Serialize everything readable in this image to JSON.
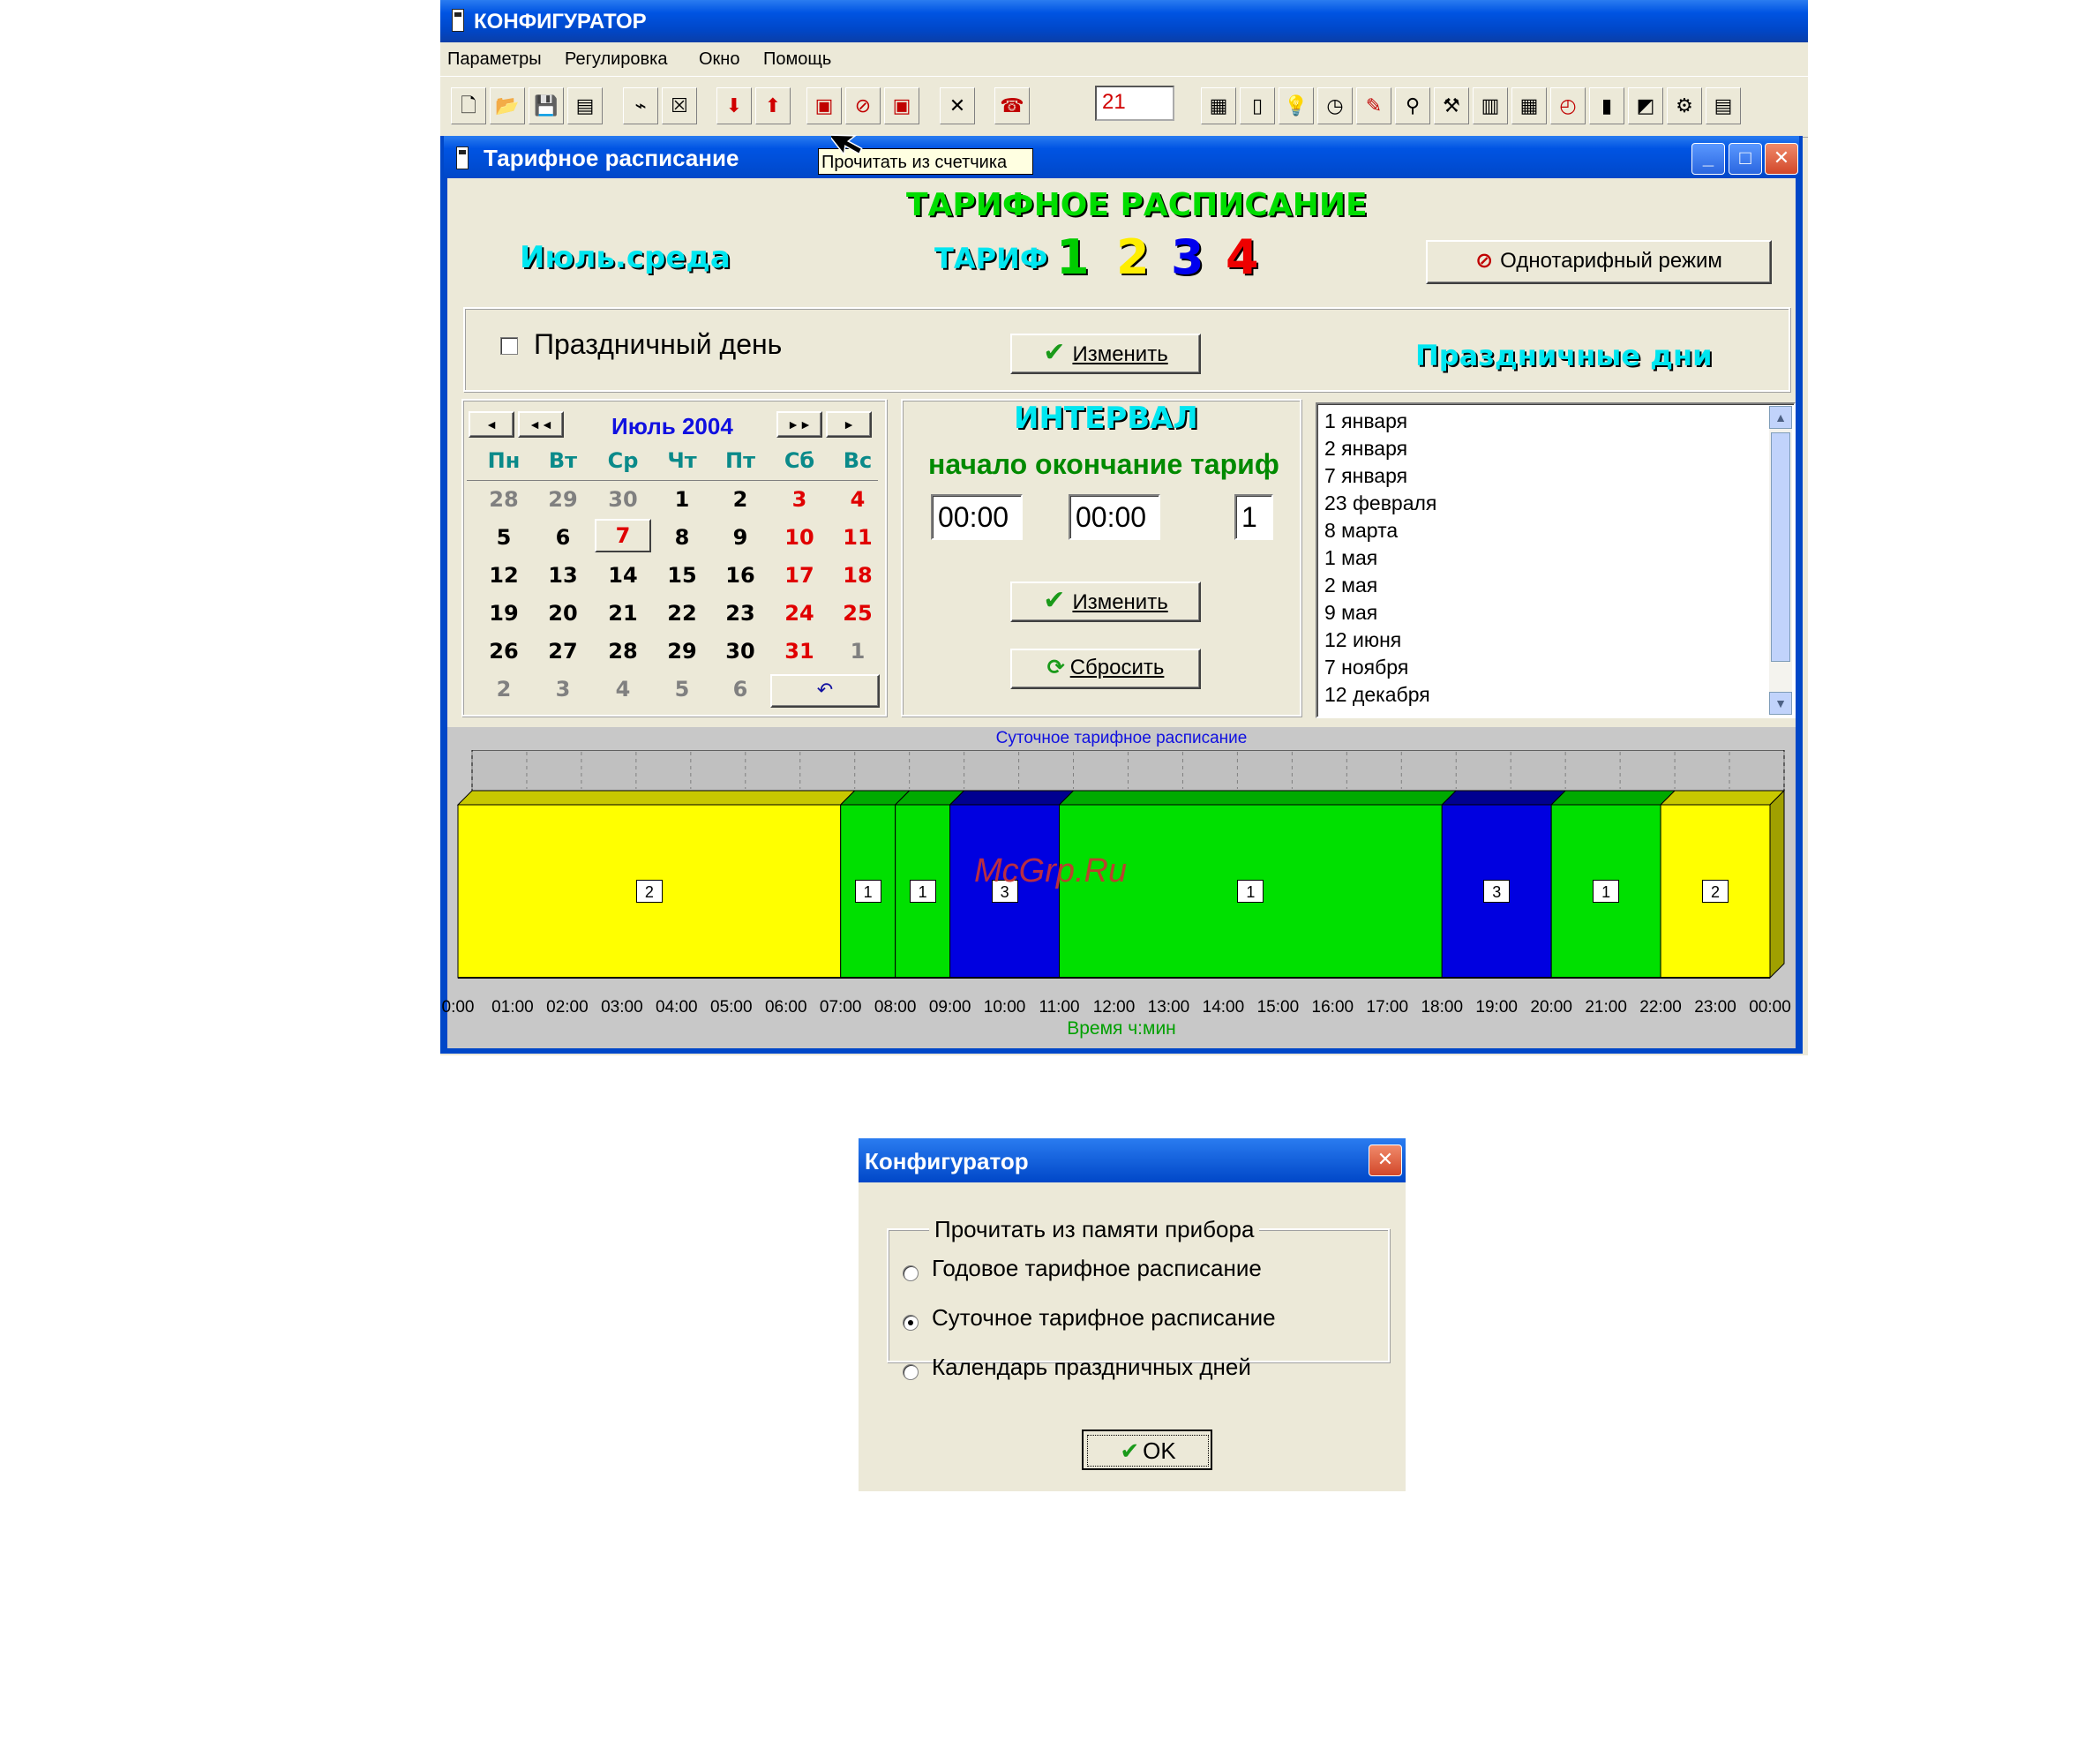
{
  "app": {
    "title": "КОНФИГУРАТОР",
    "menu": [
      "Параметры",
      "Регулировка",
      "Окно",
      "Помощь"
    ],
    "toolbar_input_value": "21"
  },
  "tooltip": "Прочитать из счетчика",
  "child_window": {
    "title": "Тарифное расписание",
    "heading": "ТАРИФНОЕ РАСПИСАНИЕ",
    "date_label": "Июль.среда",
    "tariff_label": "ТАРИФ",
    "tariff_numbers": [
      "1",
      "2",
      "3",
      "4"
    ],
    "tariff_colors": [
      "#00cc00",
      "#ffee00",
      "#0000ee",
      "#ee0000"
    ],
    "single_tariff_button": "Однотарифный режим",
    "holiday_checkbox_label": "Праздничный день",
    "change_button": "Изменить",
    "holidays_heading": "Праздничные дни",
    "calendar": {
      "month_label": "Июль 2004",
      "weekdays": [
        "Пн",
        "Вт",
        "Ср",
        "Чт",
        "Пт",
        "Сб",
        "Вс"
      ],
      "weeks": [
        [
          "28",
          "29",
          "30",
          "1",
          "2",
          "3",
          "4"
        ],
        [
          "5",
          "6",
          "7",
          "8",
          "9",
          "10",
          "11"
        ],
        [
          "12",
          "13",
          "14",
          "15",
          "16",
          "17",
          "18"
        ],
        [
          "19",
          "20",
          "21",
          "22",
          "23",
          "24",
          "25"
        ],
        [
          "26",
          "27",
          "28",
          "29",
          "30",
          "31",
          "1"
        ],
        [
          "2",
          "3",
          "4",
          "5",
          "6",
          "",
          ""
        ]
      ],
      "selected_day": "7",
      "nav": [
        "◄",
        "◄◄",
        "►►",
        "►"
      ],
      "undo_icon": "↶"
    },
    "interval": {
      "heading": "ИНТЕРВАЛ",
      "columns_label": "начало окончание тариф",
      "start": "00:00",
      "end": "00:00",
      "tariff": "1",
      "change_button": "Изменить",
      "reset_button": "Сбросить"
    },
    "holidays": [
      "1 января",
      "2 января",
      "7 января",
      "23 февраля",
      "8 марта",
      "1 мая",
      "2 мая",
      "9 мая",
      "12 июня",
      "7 ноября",
      "12 декабря"
    ]
  },
  "chart_data": {
    "type": "bar",
    "title": "Суточное тарифное расписание",
    "xlabel": "Время ч:мин",
    "ylabel": "",
    "x_ticks": [
      "0:00",
      "01:00",
      "02:00",
      "03:00",
      "04:00",
      "05:00",
      "06:00",
      "07:00",
      "08:00",
      "09:00",
      "10:00",
      "11:00",
      "12:00",
      "13:00",
      "14:00",
      "15:00",
      "16:00",
      "17:00",
      "18:00",
      "19:00",
      "20:00",
      "21:00",
      "22:00",
      "23:00",
      "00:00"
    ],
    "xlim": [
      0,
      24
    ],
    "segments": [
      {
        "start": 0,
        "end": 7,
        "tariff": "2",
        "color": "#ffff00"
      },
      {
        "start": 7,
        "end": 8,
        "tariff": "1",
        "color": "#00e000"
      },
      {
        "start": 8,
        "end": 9,
        "tariff": "1",
        "color": "#00e000"
      },
      {
        "start": 9,
        "end": 11,
        "tariff": "3",
        "color": "#0000e0"
      },
      {
        "start": 11,
        "end": 18,
        "tariff": "1",
        "color": "#00e000"
      },
      {
        "start": 18,
        "end": 20,
        "tariff": "3",
        "color": "#0000e0"
      },
      {
        "start": 20,
        "end": 22,
        "tariff": "1",
        "color": "#00e000"
      },
      {
        "start": 22,
        "end": 24,
        "tariff": "2",
        "color": "#ffff00"
      }
    ]
  },
  "watermark": "McGrp.Ru",
  "dialog": {
    "title": "Конфигуратор",
    "group_label": "Прочитать из  памяти прибора",
    "options": [
      "Годовое тарифное расписание",
      "Суточное тарифное расписание",
      "Календарь праздничных дней"
    ],
    "selected_index": 1,
    "ok_button": "OK"
  }
}
